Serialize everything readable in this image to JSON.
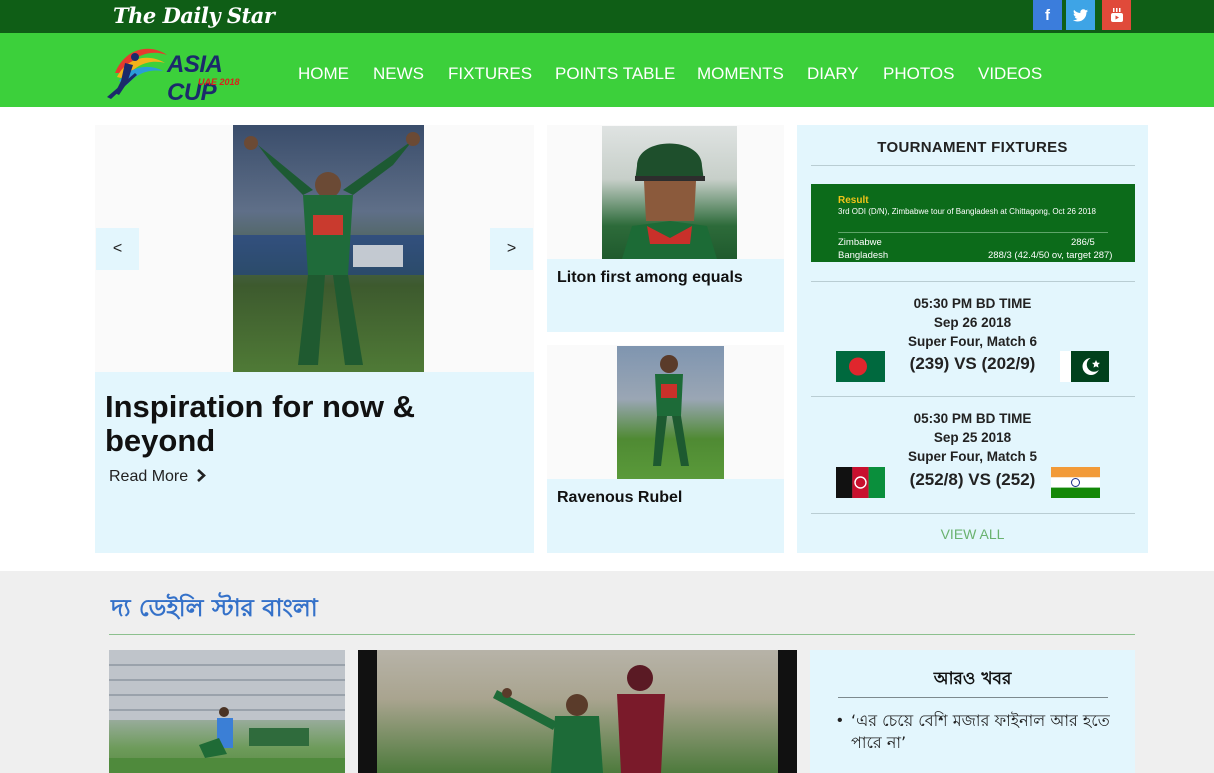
{
  "topbar": {
    "masthead": "The Daily Star",
    "social": [
      {
        "name": "facebook",
        "glyph": "f",
        "color": "#3b7ddc"
      },
      {
        "name": "twitter",
        "glyph": "t",
        "color": "#3ea4e6"
      },
      {
        "name": "youtube",
        "glyph": "▶",
        "color": "#e04a3a"
      }
    ]
  },
  "logo": {
    "title": "ASIA CUP",
    "subtitle": "UAE 2018"
  },
  "nav": {
    "items": [
      "HOME",
      "NEWS",
      "FIXTURES",
      "POINTS TABLE",
      "MOMENTS",
      "DIARY",
      "PHOTOS",
      "VIDEOS"
    ]
  },
  "hero": {
    "title": "Inspiration for now & beyond",
    "read_more": "Read More",
    "prev": "<",
    "next": ">"
  },
  "stories": [
    {
      "title": "Liton first among equals"
    },
    {
      "title": "Ravenous Rubel"
    }
  ],
  "fixtures": {
    "heading": "TOURNAMENT FIXTURES",
    "scorebox": {
      "result_label": "Result",
      "description": "3rd ODI (D/N), Zimbabwe tour of Bangladesh at Chittagong, Oct 26 2018",
      "team1": "Zimbabwe",
      "score1": "286/5",
      "team2": "Bangladesh",
      "score2": "288/3 (42.4/50 ov, target 287)"
    },
    "matches": [
      {
        "time": "05:30 PM BD TIME",
        "date": "Sep 26 2018",
        "stage": "Super Four, Match 6",
        "score": "(239) VS (202/9)",
        "team_a": "bangladesh-flag",
        "team_b": "pakistan-flag"
      },
      {
        "time": "05:30 PM BD TIME",
        "date": "Sep 25 2018",
        "stage": "Super Four, Match 5",
        "score": "(252/8) VS (252)",
        "team_a": "afghanistan-flag",
        "team_b": "india-flag"
      }
    ],
    "view_all": "VIEW ALL"
  },
  "bangla": {
    "title": "দ্য ডেইলি স্টার বাংলা",
    "more_news": {
      "heading": "আরও খবর",
      "items": [
        "‘এর চেয়ে বেশি মজার ফাইনাল আর হতে পারে না’"
      ]
    }
  },
  "colors": {
    "topbar": "#0f5e16",
    "navbar": "#3cd03b",
    "panel": "#e3f6fd",
    "accent_blue": "#3471c9",
    "score_green": "#0c6b1a"
  }
}
